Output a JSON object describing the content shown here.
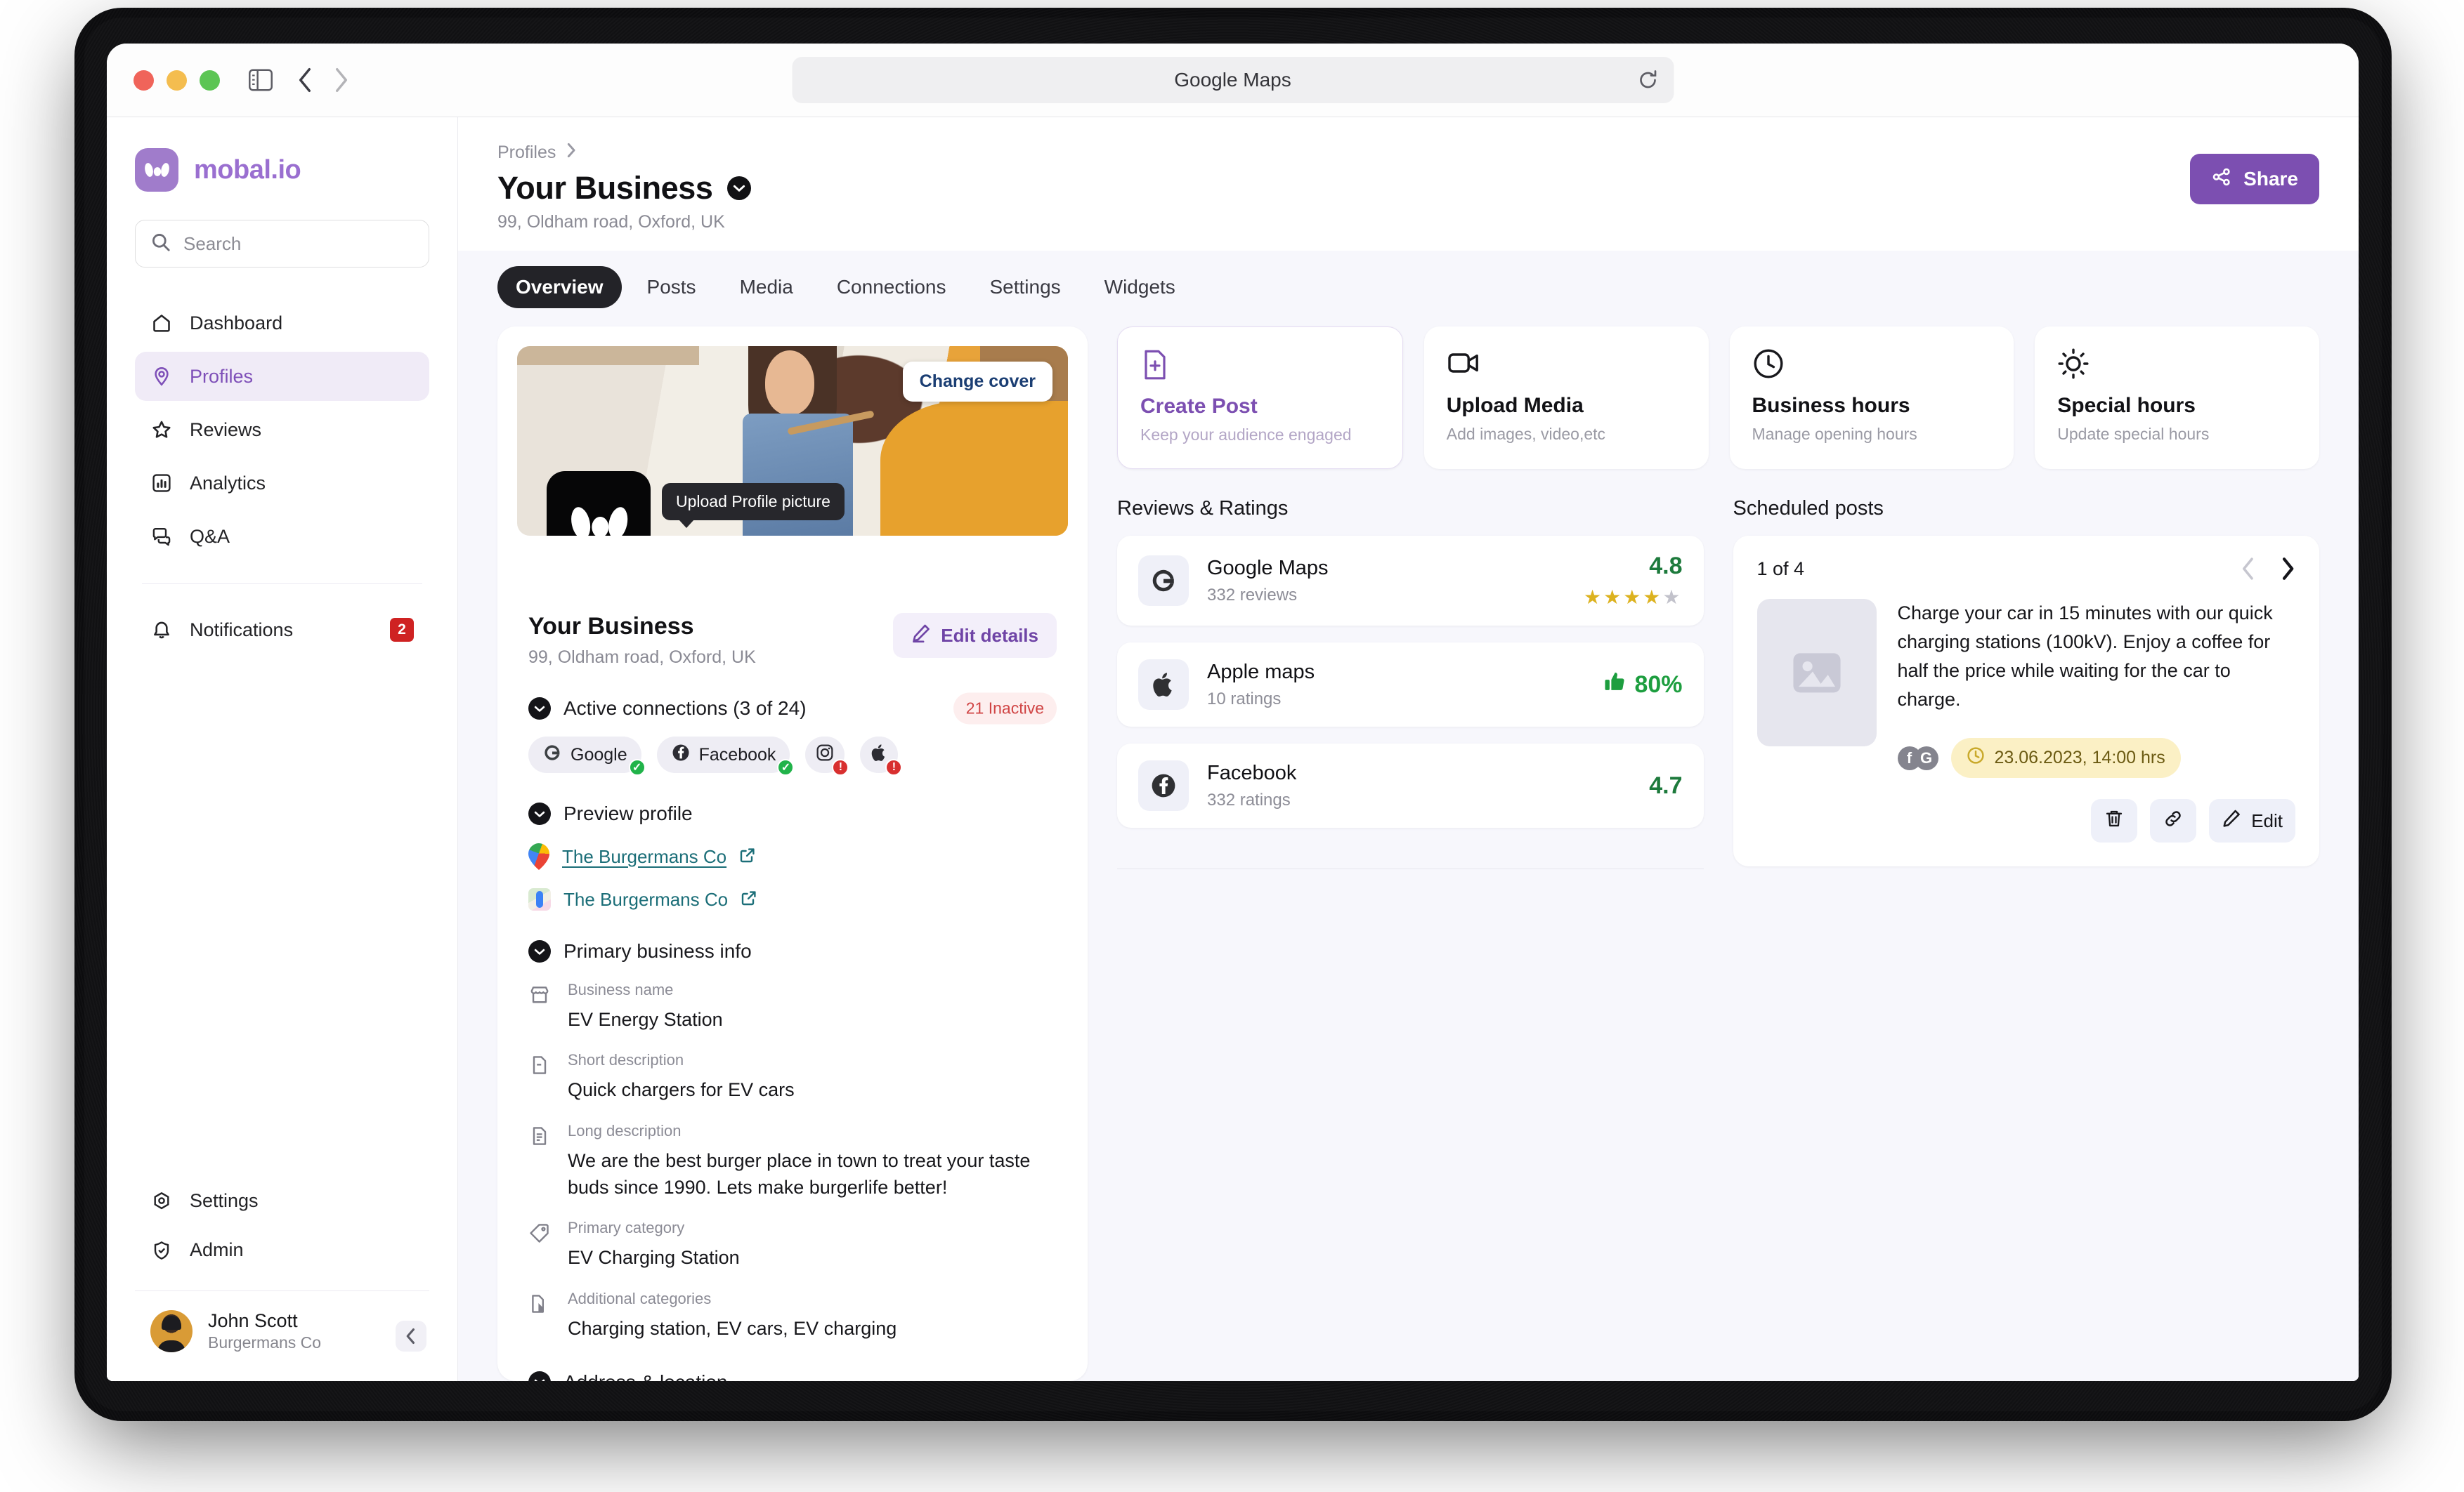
{
  "browser": {
    "url_title": "Google Maps",
    "traffic_lights": [
      "close",
      "minimize",
      "zoom"
    ],
    "icons": [
      "sidebar-toggle-icon",
      "back-icon",
      "forward-icon",
      "shield-icon",
      "reload-icon"
    ]
  },
  "sidebar": {
    "brand": "mobal.io",
    "search": {
      "placeholder": "Search",
      "value": ""
    },
    "items": [
      {
        "label": "Dashboard",
        "icon": "home-icon",
        "active": false
      },
      {
        "label": "Profiles",
        "icon": "location-pin-icon",
        "active": true
      },
      {
        "label": "Reviews",
        "icon": "star-icon",
        "active": false
      },
      {
        "label": "Analytics",
        "icon": "bar-chart-icon",
        "active": false
      },
      {
        "label": "Q&A",
        "icon": "chat-bubble-icon",
        "active": false
      },
      {
        "label": "Notifications",
        "icon": "bell-icon",
        "active": false,
        "badge": "2"
      }
    ],
    "bottom_items": [
      {
        "label": "Settings",
        "icon": "gear-icon"
      },
      {
        "label": "Admin",
        "icon": "shield-check-icon"
      }
    ],
    "user": {
      "name": "John Scott",
      "company": "Burgermans Co"
    }
  },
  "header": {
    "breadcrumb": "Profiles",
    "title": "Your Business",
    "address": "99, Oldham road, Oxford, UK",
    "share_label": "Share"
  },
  "tabs": [
    {
      "label": "Overview",
      "active": true
    },
    {
      "label": "Posts",
      "active": false
    },
    {
      "label": "Media",
      "active": false
    },
    {
      "label": "Connections",
      "active": false
    },
    {
      "label": "Settings",
      "active": false
    },
    {
      "label": "Widgets",
      "active": false
    }
  ],
  "profile_card": {
    "change_cover_label": "Change cover",
    "upload_tooltip": "Upload Profile picture",
    "business_name": "Your Business",
    "business_address": "99, Oldham road, Oxford, UK",
    "edit_details_label": "Edit details",
    "connections": {
      "title": "Active connections (3 of 24)",
      "inactive_badge": "21 Inactive",
      "chips": [
        {
          "label": "Google",
          "icon": "google-icon",
          "status": "ok"
        },
        {
          "label": "Facebook",
          "icon": "facebook-icon",
          "status": "ok"
        },
        {
          "label": "",
          "icon": "instagram-icon",
          "status": "warn"
        },
        {
          "label": "",
          "icon": "apple-icon",
          "status": "warn"
        }
      ]
    },
    "preview": {
      "title": "Preview profile",
      "links": [
        {
          "label": "The Burgermans Co",
          "icon": "google-maps-pin-icon"
        },
        {
          "label": "The Burgermans Co",
          "icon": "apple-maps-icon"
        }
      ]
    },
    "primary_info": {
      "title": "Primary business info",
      "fields": [
        {
          "label": "Business name",
          "value": "EV Energy Station",
          "icon": "storefront-icon"
        },
        {
          "label": "Short description",
          "value": "Quick chargers for EV cars",
          "icon": "document-minus-icon"
        },
        {
          "label": "Long description",
          "value": "We are the best burger place in town to treat your taste buds since 1990. Lets make burgerlife better!",
          "icon": "document-lines-icon"
        },
        {
          "label": "Primary category",
          "value": "EV Charging Station",
          "icon": "tag-icon"
        },
        {
          "label": "Additional categories",
          "value": "Charging station, EV cars, EV charging",
          "icon": "documents-icon"
        }
      ]
    },
    "address_section": {
      "title": "Address & location"
    }
  },
  "quick_actions": [
    {
      "title": "Create Post",
      "subtitle": "Keep your audience engaged",
      "icon": "file-plus-icon",
      "accent": true
    },
    {
      "title": "Upload Media",
      "subtitle": "Add images, video,etc",
      "icon": "video-camera-icon",
      "accent": false
    },
    {
      "title": "Business hours",
      "subtitle": "Manage opening hours",
      "icon": "clock-icon",
      "accent": false
    },
    {
      "title": "Special hours",
      "subtitle": "Update special hours",
      "icon": "sun-icon",
      "accent": false
    }
  ],
  "reviews": {
    "title": "Reviews & Ratings",
    "items": [
      {
        "name": "Google Maps",
        "count": "332 reviews",
        "score": "4.8",
        "icon": "google-icon",
        "type": "stars",
        "stars_filled": 4,
        "stars_total": 5
      },
      {
        "name": "Apple maps",
        "count": "10 ratings",
        "score": "80%",
        "icon": "apple-icon",
        "type": "percent"
      },
      {
        "name": "Facebook",
        "count": "332 ratings",
        "score": "4.7",
        "icon": "facebook-icon",
        "type": "score"
      }
    ]
  },
  "scheduled": {
    "title": "Scheduled posts",
    "counter": "1 of 4",
    "post_text": "Charge your car in 15 minutes with our quick charging stations (100kV). Enjoy a coffee for half the price while waiting for the car to charge.",
    "platform_icons": [
      "facebook-icon",
      "google-icon"
    ],
    "date_badge": "23.06.2023, 14:00 hrs",
    "actions": [
      {
        "label": "",
        "icon": "trash-icon"
      },
      {
        "label": "",
        "icon": "link-icon"
      },
      {
        "label": "Edit",
        "icon": "pencil-icon"
      }
    ]
  },
  "colors": {
    "accent_purple": "#7c4fb1",
    "brand_purple": "#9a6fd0",
    "green": "#1d7a3c",
    "red": "#d04444",
    "star_gold": "#dcb21f",
    "yellow_badge": "#fbf0c5"
  }
}
